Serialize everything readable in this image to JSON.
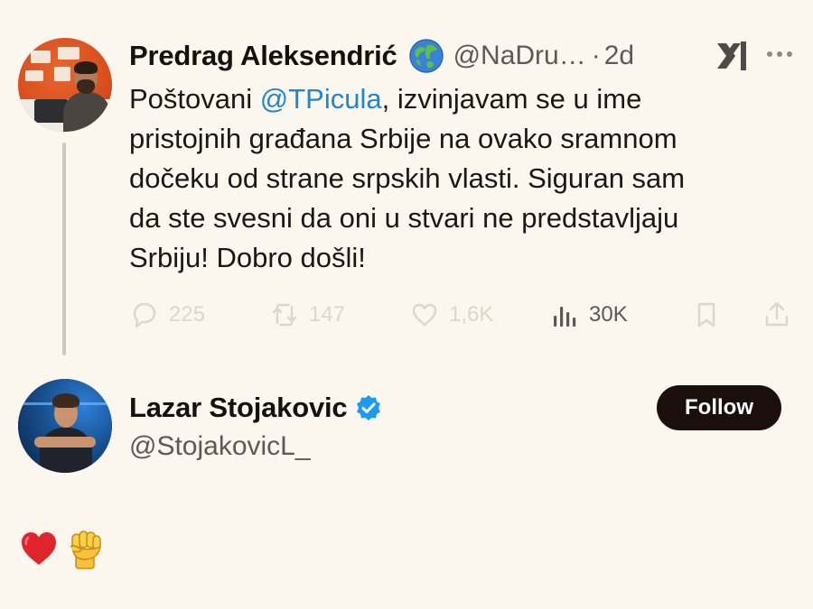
{
  "parent_tweet": {
    "author": {
      "name": "Predrag Aleksendrić",
      "handle": "@NaDru…",
      "badge_icon": "globe-icon"
    },
    "separator": "·",
    "time": "2d",
    "text_lines": [
      [
        "Poštovani ",
        "@TPicula",
        ", izvinjavam se u ime"
      ],
      [
        "pristojnih građana Srbije na ovako sramnom"
      ],
      [
        "dočeku od strane srpskih vlasti. Siguran sam"
      ],
      [
        "da ste svesni da oni u stvari ne predstavljaju"
      ],
      [
        "Srbiju! Dobro došli!"
      ]
    ],
    "mention": "@TPicula",
    "actions": {
      "replies": "225",
      "retweets": "147",
      "likes": "1,6K",
      "views": "30K"
    }
  },
  "reply_tweet": {
    "author": {
      "name": "Lazar Stojakovic",
      "handle": "@StojakovicL_",
      "verified": true
    },
    "follow_label": "Follow",
    "content_icons": [
      "heart-icon",
      "raised-fist-icon"
    ]
  },
  "colors": {
    "background": "#fbf7ee",
    "mention": "#1d86d6",
    "verified": "#1d9bf0",
    "follow_button": "#1b0f0b",
    "muted_text": "#5d5a55"
  }
}
